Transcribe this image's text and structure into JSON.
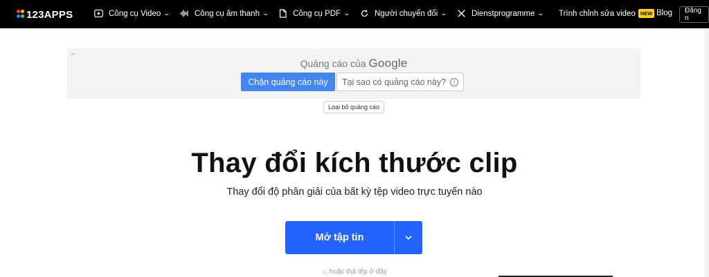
{
  "nav": {
    "logo_text": "123APPS",
    "items": [
      {
        "label": "Công cụ Video",
        "icon": "video-play-icon"
      },
      {
        "label": "Công cụ âm thanh",
        "icon": "audio-wave-icon"
      },
      {
        "label": "Công cụ PDF",
        "icon": "pdf-file-icon"
      },
      {
        "label": "Người chuyển đổi",
        "icon": "convert-icon"
      },
      {
        "label": "Dienstprogramme",
        "icon": "tools-icon"
      }
    ],
    "editor_label": "Trình chỉnh sửa video",
    "new_badge": "NEW",
    "blog_label": "Blog",
    "login_label": "Đăng n"
  },
  "ad": {
    "prefix": "Quảng cáo của",
    "brand": "Google",
    "block_label": "Chặn quảng cáo này",
    "why_label": "Tại sao có quảng cáo này?",
    "remove_label": "Loại bỏ quảng cáo"
  },
  "hero": {
    "title": "Thay đổi kích thước clip",
    "subtitle": "Thay đổi độ phân giải của bất kỳ tệp video trực tuyến nào",
    "open_label": "Mở tập tin",
    "drop_hint": "hoặc thả tệp ở đây"
  },
  "colors": {
    "nav_bg": "#000000",
    "primary": "#2563ff",
    "google_blue": "#4285f4",
    "badge": "#ffd400"
  }
}
